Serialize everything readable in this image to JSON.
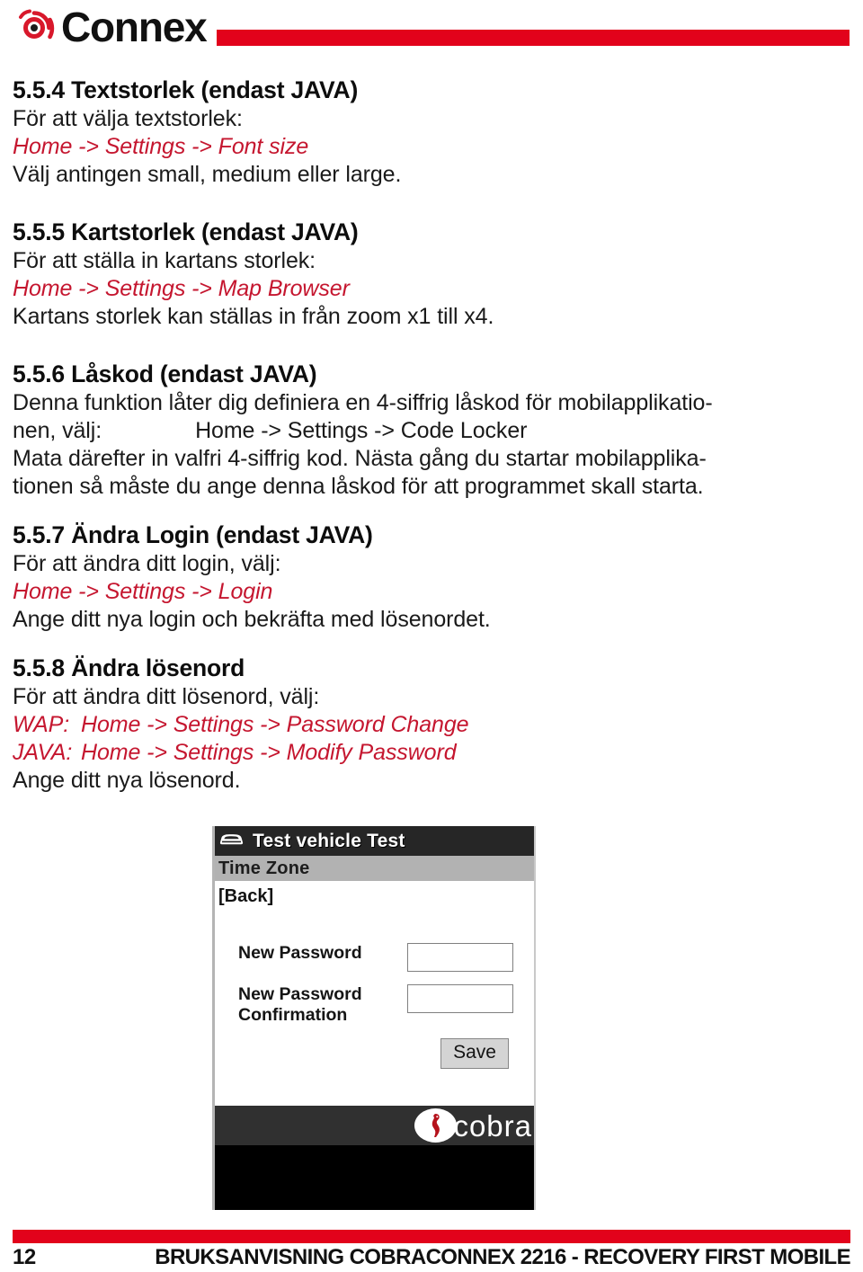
{
  "header": {
    "logo_text": "Connex",
    "logo_icon": "connex-spiral-logo",
    "accent_color": "#e2021b"
  },
  "colors": {
    "accent_red": "#e2021b",
    "path_crimson": "#c5162f",
    "body_text": "#1a1a1a"
  },
  "sections": [
    {
      "heading": "5.5.4 Textstorlek (endast JAVA)",
      "intro": "För att välja textstorlek:",
      "path": "Home -> Settings -> Font size",
      "outro": "Välj antingen small, medium eller large."
    },
    {
      "heading": "5.5.5 Kartstorlek (endast JAVA)",
      "intro": "För att ställa in kartans storlek:",
      "path": "Home -> Settings -> Map Browser",
      "outro": "Kartans storlek kan ställas in från zoom x1 till x4."
    },
    {
      "heading": "5.5.6 Låskod (endast JAVA)",
      "intro_line1": "Denna funktion låter dig definiera en 4-siffrig låskod för mobilapplikatio-",
      "intro_line2_prefix": "nen, välj:",
      "path": "Home -> Settings -> Code Locker",
      "outro_line1": "Mata därefter in valfri 4-siffrig kod. Nästa gång du startar mobilapplika-",
      "outro_line2": "tionen så måste du ange denna låskod för att programmet skall starta."
    },
    {
      "heading": "5.5.7 Ändra Login (endast JAVA)",
      "intro": "För att ändra ditt login, välj:",
      "path": "Home -> Settings -> Login",
      "outro": "Ange ditt nya login och bekräfta med lösenordet."
    },
    {
      "heading": "5.5.8 Ändra lösenord",
      "intro": "För att ändra ditt lösenord, välj:",
      "path_wap_prefix": "WAP:",
      "path_wap": "Home -> Settings -> Password Change",
      "path_java_prefix": "JAVA:",
      "path_java": "Home -> Settings -> Modify Password",
      "outro": "Ange ditt nya lösenord."
    }
  ],
  "screenshot": {
    "title": "Test vehicle Test",
    "title_icon": "car-icon",
    "subbar_label": "Time Zone",
    "back_link": "[Back]",
    "fields": [
      {
        "label": "New Password",
        "value": ""
      },
      {
        "label": "New Password Confirmation",
        "value": ""
      }
    ],
    "save_label": "Save",
    "brand_word": "cobra",
    "brand_icon": "cobra-snake-icon"
  },
  "footer": {
    "page_number": "12",
    "title": "BRUKSANVISNING COBRACONNEX 2216 - RECOVERY FIRST MOBILE"
  }
}
